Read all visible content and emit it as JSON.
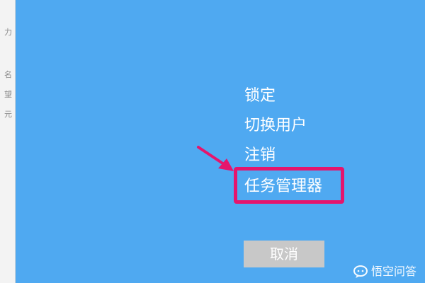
{
  "left_panel": {
    "ghost_chars": [
      "力",
      "名",
      "望",
      "元"
    ]
  },
  "menu": {
    "items": [
      {
        "label": "锁定"
      },
      {
        "label": "切换用户"
      },
      {
        "label": "注销"
      },
      {
        "label": "任务管理器",
        "highlighted": true
      }
    ],
    "cancel_label": "取消"
  },
  "annotation": {
    "arrow_icon": "arrow-icon",
    "highlight_color": "#e5156d"
  },
  "watermark": {
    "text": "悟空问答",
    "icon": "chat-bubble-icon"
  },
  "colors": {
    "background": "#4fa9f1",
    "text": "#ffffff",
    "cancel_button": "#c8c8c8"
  }
}
